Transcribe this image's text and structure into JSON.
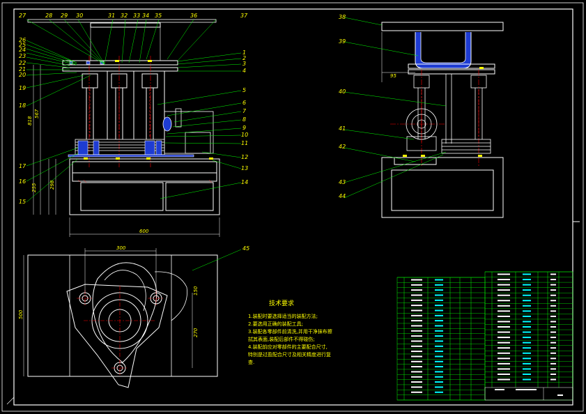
{
  "drawing": {
    "front_view_labels_top": [
      "27",
      "28",
      "29",
      "30",
      "31",
      "32",
      "33",
      "34",
      "35",
      "36",
      "37"
    ],
    "front_view_labels_left": [
      "26",
      "25",
      "24",
      "23",
      "22",
      "21",
      "20",
      "19",
      "18",
      "17",
      "16",
      "15"
    ],
    "front_view_labels_right": [
      "1",
      "2",
      "3",
      "4",
      "5",
      "6",
      "7",
      "8",
      "9",
      "10",
      "11",
      "12",
      "13",
      "14"
    ],
    "side_view_labels": [
      "38",
      "39",
      "40",
      "41",
      "42",
      "43",
      "44"
    ],
    "bottom_view_label": "45",
    "dimensions": {
      "front_width": "600",
      "front_height_total": "818",
      "front_height_upper": "567",
      "front_height_base": "298",
      "front_height_mid": "255",
      "side_offset": "95",
      "plan_width": "300",
      "plan_height": "500",
      "plan_r1": "150",
      "plan_r2": "270"
    },
    "colors": {
      "line": "#ffffff",
      "label": "#ffff00",
      "center_line": "#ff0000",
      "part_fill": "#1e3cd2",
      "leader": "#00ff00",
      "hatch": "#ff2020",
      "table": "#00ff00",
      "cyan": "#00ffff"
    }
  },
  "technical_notes": {
    "title": "技术要求",
    "items": [
      "1.装配时要选择适当的装配方法;",
      "2.要选用正确的装配工具;",
      "3.装配各零部件前清洗,并用干净抹布擦",
      "拭其表面,装配后部件不得碰伤;",
      "4.装配前应对零部件的主要配合尺寸,",
      "特别是过盈配合尺寸及相关精度进行复",
      "查."
    ]
  },
  "title_block": {
    "company_cell": "",
    "drawing_no": ""
  }
}
